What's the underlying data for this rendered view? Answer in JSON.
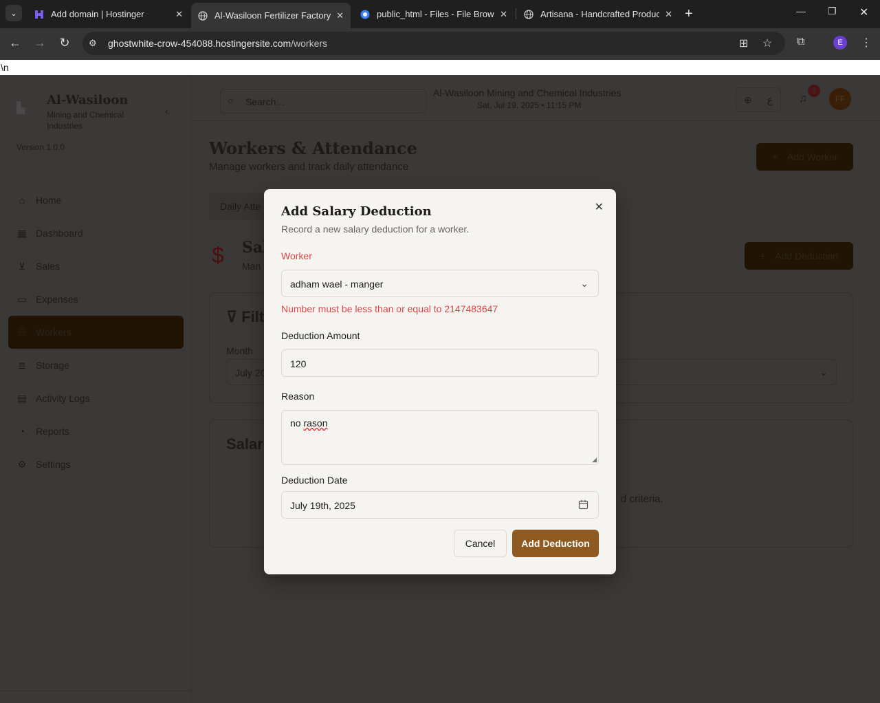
{
  "browser": {
    "tabs": [
      {
        "title": "Add domain | Hostinger"
      },
      {
        "title": "Al-Wasiloon Fertilizer Factory M"
      },
      {
        "title": "public_html - Files - File Browse"
      },
      {
        "title": "Artisana - Handcrafted Product"
      }
    ],
    "url_host": "ghostwhite-crow-454088.hostingersite.com",
    "url_path": "/workers",
    "profile_initial": "E"
  },
  "stray_text": "\\n",
  "app": {
    "brand": "Al-Wasiloon",
    "brand_sub": "Mining and Chemical Industries",
    "version": "Version 1.0.0",
    "nav": [
      "Home",
      "Dashboard",
      "Sales",
      "Expenses",
      "Workers",
      "Storage",
      "Activity Logs",
      "Reports",
      "Settings"
    ],
    "search_placeholder": "Search...",
    "company_name": "Al-Wasiloon Mining and Chemical Industries",
    "date_time": "Sat, Jul 19, 2025 • 11:15 PM",
    "lang_label": "ع",
    "notifications_count": "3",
    "avatar_initials": "FF",
    "page_title": "Workers & Attendance",
    "page_subtitle": "Manage workers and track daily attendance",
    "add_worker": "Add Worker",
    "tab_label": "Daily Atte",
    "section_title": "Sal",
    "section_sub": "Man",
    "add_deduction_bg": "Add Deduction",
    "filter_title": "Filt",
    "month_label": "Month",
    "month_value": "July 20",
    "list_title": "Salar",
    "empty_msg_tail": "d criteria."
  },
  "modal": {
    "title": "Add Salary Deduction",
    "description": "Record a new salary deduction for a worker.",
    "worker_label": "Worker",
    "worker_value": "adham wael - manger",
    "error_message": "Number must be less than or equal to 2147483647",
    "amount_label": "Deduction Amount",
    "amount_value": "120",
    "reason_label": "Reason",
    "reason_value_a": "no ",
    "reason_value_b": "rason",
    "date_label": "Deduction Date",
    "date_value": "July 19th, 2025",
    "cancel": "Cancel",
    "submit": "Add Deduction"
  },
  "colors": {
    "accent": "#8e5a22",
    "error": "#e04545",
    "modal_bg": "#f6f4f0"
  }
}
